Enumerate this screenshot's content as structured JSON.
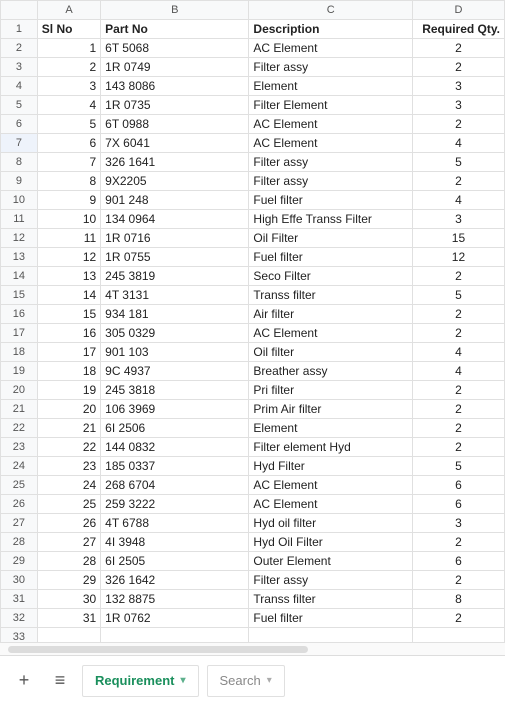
{
  "chart_data": {
    "type": "table",
    "columns": [
      "Sl No",
      "Part No",
      "Description",
      "Required Qty."
    ],
    "rows": [
      [
        1,
        "6T 5068",
        "AC Element",
        2
      ],
      [
        2,
        "1R 0749",
        "Filter assy",
        2
      ],
      [
        3,
        "143 8086",
        "Element",
        3
      ],
      [
        4,
        "1R 0735",
        "Filter Element",
        3
      ],
      [
        5,
        "6T 0988",
        "AC Element",
        2
      ],
      [
        6,
        "7X 6041",
        "AC Element",
        4
      ],
      [
        7,
        "326 1641",
        "Filter assy",
        5
      ],
      [
        8,
        "9X2205",
        "Filter assy",
        2
      ],
      [
        9,
        "901 248",
        "Fuel filter",
        4
      ],
      [
        10,
        "134 0964",
        "High Effe Transs Filter",
        3
      ],
      [
        11,
        "1R 0716",
        "Oil Filter",
        15
      ],
      [
        12,
        "1R 0755",
        "Fuel filter",
        12
      ],
      [
        13,
        "245 3819",
        "Seco Filter",
        2
      ],
      [
        14,
        "4T 3131",
        "Transs filter",
        5
      ],
      [
        15,
        "934 181",
        "Air filter",
        2
      ],
      [
        16,
        "305 0329",
        "AC Element",
        2
      ],
      [
        17,
        "901 103",
        "Oil filter",
        4
      ],
      [
        18,
        "9C 4937",
        "Breather assy",
        4
      ],
      [
        19,
        "245 3818",
        "Pri filter",
        2
      ],
      [
        20,
        "106 3969",
        "Prim Air filter",
        2
      ],
      [
        21,
        "6I 2506",
        "Element",
        2
      ],
      [
        22,
        "144 0832",
        "Filter element Hyd",
        2
      ],
      [
        23,
        "185 0337",
        "Hyd Filter",
        5
      ],
      [
        24,
        "268 6704",
        "AC Element",
        6
      ],
      [
        25,
        "259 3222",
        "AC Element",
        6
      ],
      [
        26,
        "4T 6788",
        "Hyd oil filter",
        3
      ],
      [
        27,
        "4I 3948",
        "Hyd Oil Filter",
        2
      ],
      [
        28,
        "6I 2505",
        "Outer Element",
        6
      ],
      [
        29,
        "326 1642",
        "Filter assy",
        2
      ],
      [
        30,
        "132 8875",
        "Transs filter",
        8
      ],
      [
        31,
        "1R 0762",
        "Fuel filter",
        2
      ]
    ]
  },
  "columns": {
    "letters": [
      "A",
      "B",
      "C",
      "D"
    ],
    "headers": [
      "Sl No",
      "Part No",
      "Description",
      "Required Qty."
    ]
  },
  "selected_row": 7,
  "tabs": {
    "active": "Requirement",
    "secondary": "Search"
  },
  "glyphs": {
    "plus": "+",
    "menu": "≡",
    "chev": "▾"
  }
}
